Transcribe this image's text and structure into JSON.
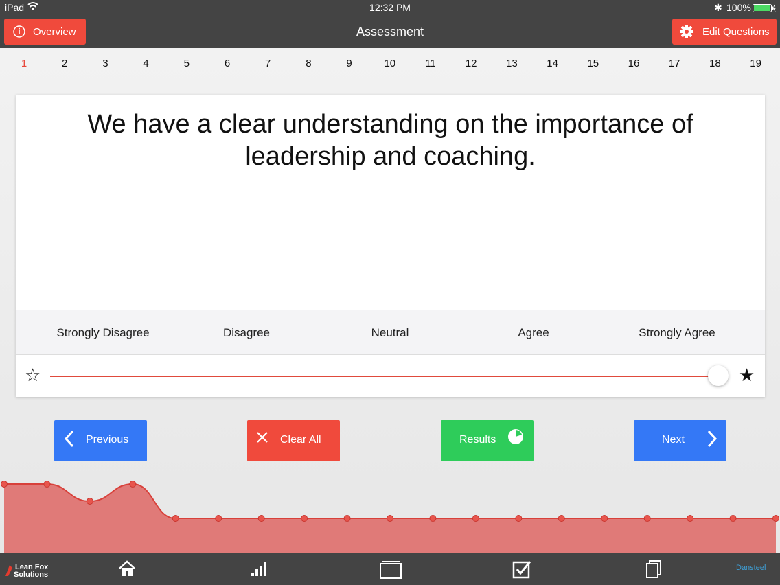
{
  "status_bar": {
    "device": "iPad",
    "time": "12:32 PM",
    "battery": "100%"
  },
  "nav": {
    "overview_label": "Overview",
    "title": "Assessment",
    "edit_label": "Edit Questions"
  },
  "questions": {
    "numbers": [
      "1",
      "2",
      "3",
      "4",
      "5",
      "6",
      "7",
      "8",
      "9",
      "10",
      "11",
      "12",
      "13",
      "14",
      "15",
      "16",
      "17",
      "18",
      "19"
    ],
    "current": "1"
  },
  "card": {
    "question": "We have a clear understanding on the importance of leadership and coaching.",
    "scale_labels": [
      "Strongly Disagree",
      "Disagree",
      "Neutral",
      "Agree",
      "Strongly Agree"
    ],
    "slider_value": 1.0
  },
  "buttons": {
    "previous": "Previous",
    "clear_all": "Clear All",
    "results": "Results",
    "next": "Next"
  },
  "graph_values": [
    5,
    5,
    4,
    5,
    3,
    3,
    3,
    3,
    3,
    3,
    3,
    3,
    3,
    3,
    3,
    3,
    3,
    3,
    3
  ],
  "footer": {
    "logo_line1": "Lean Fox",
    "logo_line2": "Solutions",
    "brand": "Dansteel"
  },
  "colors": {
    "red": "#f04a3c",
    "blue": "#3478f6",
    "green": "#2ecc5a",
    "dark": "#444444",
    "graph_fill": "#e07a78"
  },
  "icons": [
    "info-icon",
    "gear-icon",
    "chevron-left-icon",
    "close-icon",
    "pie-chart-icon",
    "chevron-right-icon",
    "home-icon",
    "bar-chart-icon",
    "folder-icon",
    "checkbox-icon",
    "documents-icon",
    "star-outline-icon",
    "star-filled-icon"
  ]
}
